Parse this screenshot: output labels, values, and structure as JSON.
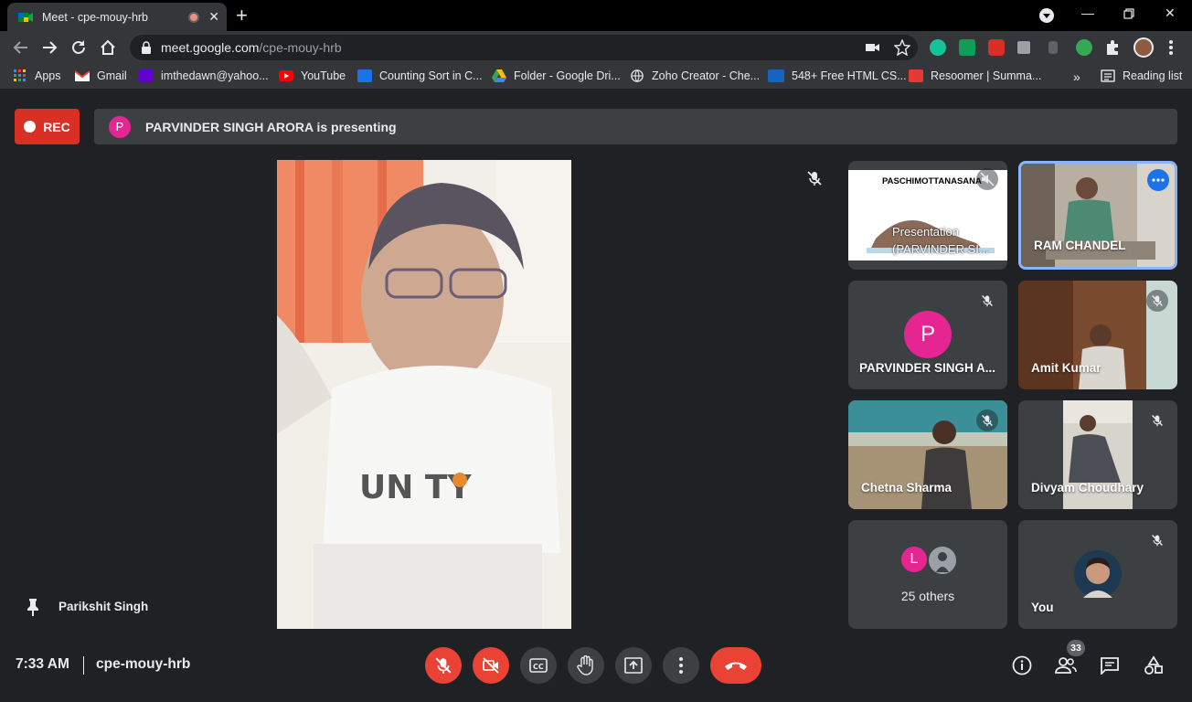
{
  "browser": {
    "tab_title": "Meet - cpe-mouy-hrb",
    "url_host": "meet.google.com",
    "url_path": "/cpe-mouy-hrb",
    "bookmarks": [
      {
        "label": "Apps",
        "icon": "apps-grid-icon"
      },
      {
        "label": "Gmail",
        "icon": "gmail-icon"
      },
      {
        "label": "imthedawn@yahoo...",
        "icon": "yahoo-icon"
      },
      {
        "label": "YouTube",
        "icon": "youtube-icon"
      },
      {
        "label": "Counting Sort in C...",
        "icon": "site-icon"
      },
      {
        "label": "Folder - Google Dri...",
        "icon": "google-drive-icon"
      },
      {
        "label": "Zoho Creator - Che...",
        "icon": "globe-icon"
      },
      {
        "label": "548+ Free HTML CS...",
        "icon": "tm-icon"
      },
      {
        "label": "Resoomer | Summa...",
        "icon": "resoomer-icon"
      }
    ],
    "reading_list": "Reading list",
    "more_bookmarks": "»"
  },
  "meet": {
    "rec_label": "REC",
    "presenter_initial": "P",
    "presenting_text": "PARVINDER SINGH ARORA is presenting",
    "pinned_name": "Parikshit Singh",
    "tiles": [
      {
        "name": "Presentation (PARVINDER SI...",
        "slide_title": "PASCHIMOTTANASANA",
        "overlay": "Presentation",
        "overlay_sub": "(PARVINDER SI..."
      },
      {
        "name": "RAM CHANDEL"
      },
      {
        "name": "PARVINDER SINGH A...",
        "initial": "P"
      },
      {
        "name": "Amit Kumar"
      },
      {
        "name": "Chetna Sharma"
      },
      {
        "name": "Divyam Choudhary"
      },
      {
        "name": "25 others",
        "initial": "L"
      },
      {
        "name": "You"
      }
    ],
    "clock": "7:33 AM",
    "meeting_code": "cpe-mouy-hrb",
    "participant_count": "33"
  },
  "colors": {
    "background": "#202124",
    "tile": "#3c4043",
    "red": "#ea4335",
    "rec": "#d93025",
    "avatar_pink": "#e52592",
    "active_speaker_border": "#8ab4f8"
  }
}
